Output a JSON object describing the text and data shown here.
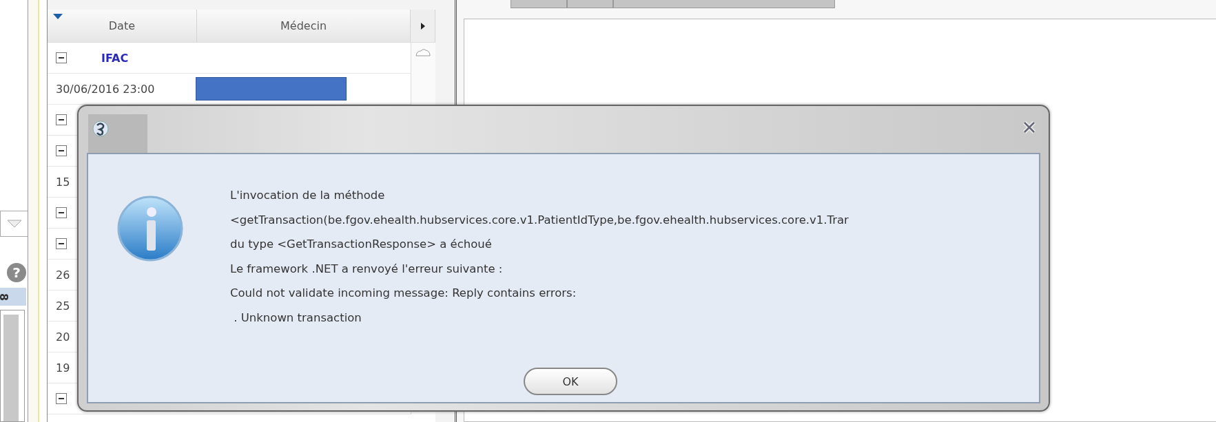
{
  "side_panel": {
    "help_icon": "?",
    "tab_label": "8"
  },
  "grid": {
    "columns": [
      "Date",
      "Médecin"
    ],
    "rows": [
      {
        "kind": "group",
        "label": "IFAC",
        "expanded": true
      },
      {
        "kind": "redacted_entry",
        "date": "30/06/2016 23:00"
      },
      {
        "kind": "group",
        "expanded": true
      },
      {
        "kind": "group",
        "expanded": true
      },
      {
        "kind": "entry",
        "date": "15"
      },
      {
        "kind": "group",
        "expanded": true
      },
      {
        "kind": "group",
        "expanded": true
      },
      {
        "kind": "entry",
        "date": "26"
      },
      {
        "kind": "entry",
        "date": "25"
      },
      {
        "kind": "entry",
        "date": "20"
      },
      {
        "kind": "entry",
        "date": "19"
      },
      {
        "kind": "group",
        "expanded": true
      }
    ]
  },
  "dialog": {
    "message": [
      "L'invocation de la méthode",
      "<getTransaction(be.fgov.ehealth.hubservices.core.v1.PatientIdType,be.fgov.ehealth.hubservices.core.v1.Trar",
      "du type <GetTransactionResponse> a échoué",
      "Le framework .NET a renvoyé l'erreur suivante :",
      "Could not validate incoming message: Reply contains errors:",
      " . Unknown transaction"
    ],
    "buttons": [
      "OK"
    ]
  }
}
